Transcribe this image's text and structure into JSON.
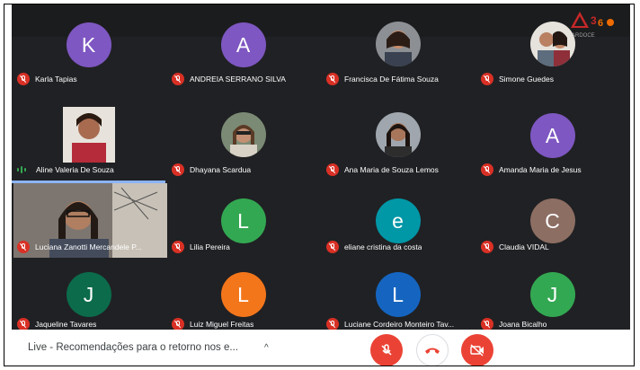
{
  "colors": {
    "stage_bg": "#202124",
    "muted_red": "#d93025",
    "speaking_green": "#34a853"
  },
  "participants": [
    {
      "name": "Karla Tapias",
      "initial": "K",
      "color": "#7e57c2"
    },
    {
      "name": "ANDREIA SERRANO SILVA",
      "initial": "A",
      "color": "#7e57c2"
    },
    {
      "name": "Francisca De Fátima Souza",
      "photo": true
    },
    {
      "name": "Simone Guedes",
      "photo": true
    },
    {
      "name": "Aline Valeria De Souza",
      "video": true,
      "speaking": true
    },
    {
      "name": "Dhayana Scardua",
      "photo": true
    },
    {
      "name": "Ana Maria de Souza Lemos",
      "photo": true
    },
    {
      "name": "Amanda Maria de Jesus",
      "initial": "A",
      "color": "#7e57c2"
    },
    {
      "name": "Luciana Zanotti Mercandele P...",
      "video": true,
      "active": true
    },
    {
      "name": "Lilia Pereira",
      "initial": "L",
      "color": "#33a852"
    },
    {
      "name": "eliane cristina da costa",
      "initial": "e",
      "color": "#0097a7"
    },
    {
      "name": "Claudia VIDAL",
      "initial": "C",
      "color": "#8d6e63"
    },
    {
      "name": "Jaqueline Tavares",
      "initial": "J",
      "color": "#0b6b4b"
    },
    {
      "name": "Luiz Miguel Freitas",
      "initial": "L",
      "color": "#f4761b"
    },
    {
      "name": "Luciane Cordeiro Monteiro Tav...",
      "initial": "L",
      "color": "#1565c0"
    },
    {
      "name": "Joana Bicalho",
      "initial": "J",
      "color": "#33a852"
    }
  ],
  "meeting": {
    "title": "Live - Recomendações para o retorno nos e...",
    "chevron": "^"
  },
  "controls": {
    "mic_icon": "mic-off-icon",
    "hangup_icon": "call-end-icon",
    "camera_icon": "videocam-off-icon"
  }
}
